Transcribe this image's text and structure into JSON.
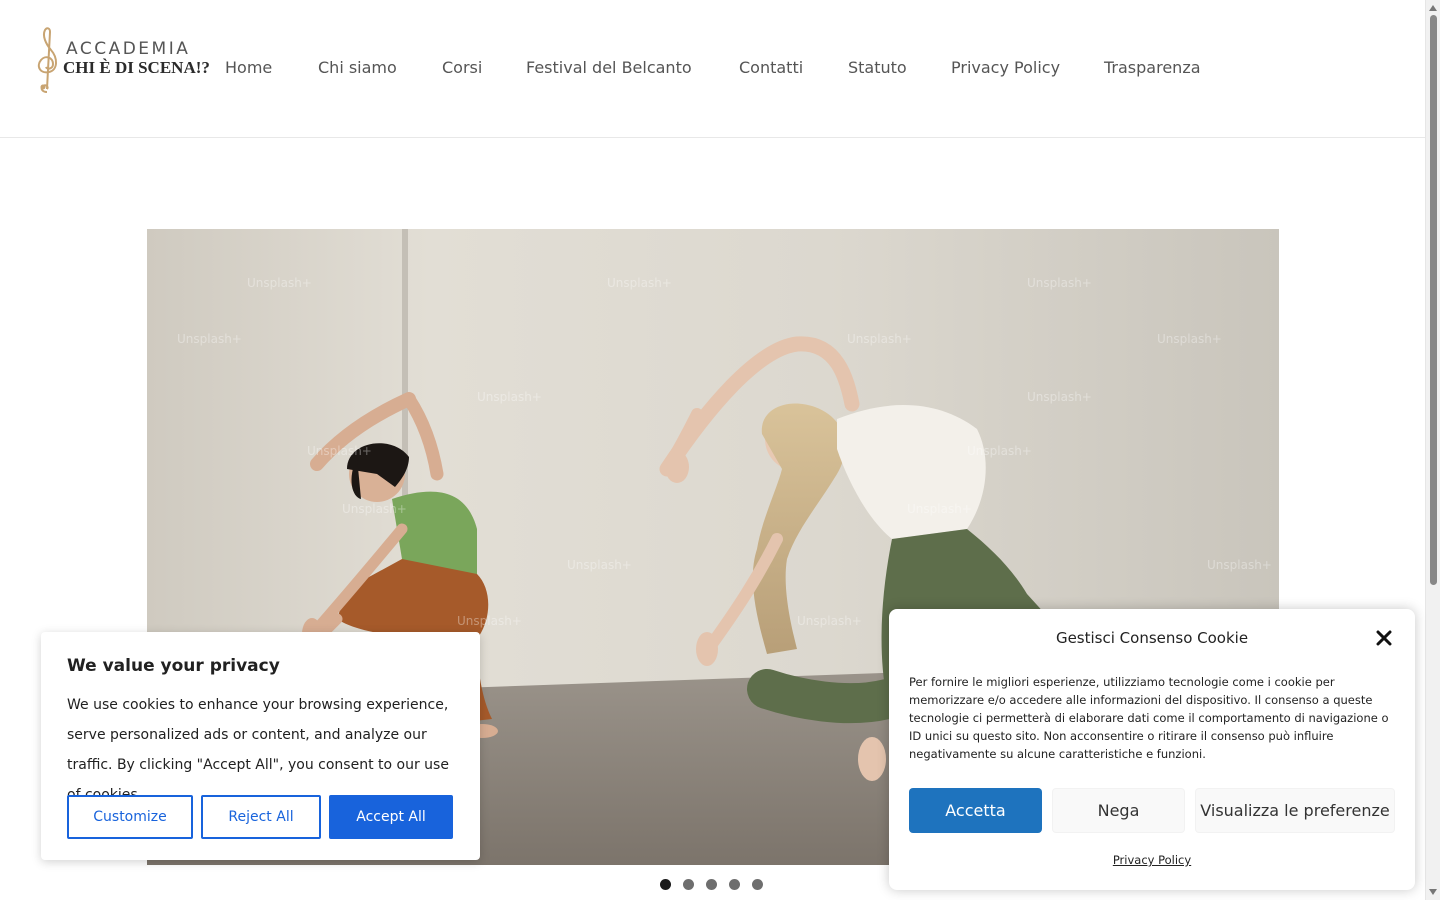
{
  "header": {
    "logo": {
      "line1": "ACCADEMIA",
      "line2": "CHI È DI SCENA!?",
      "icon": "treble-clef-icon",
      "color": "#c8a472"
    },
    "nav": [
      {
        "label": "Home"
      },
      {
        "label": "Chi siamo"
      },
      {
        "label": "Corsi"
      },
      {
        "label": "Festival del Belcanto"
      },
      {
        "label": "Contatti"
      },
      {
        "label": "Statuto"
      },
      {
        "label": "Privacy Policy"
      },
      {
        "label": "Trasparenza"
      }
    ]
  },
  "hero": {
    "watermark": "Unsplash+",
    "slides": 5,
    "active_slide": 1
  },
  "privacy_card": {
    "title": "We value your privacy",
    "text": "We use cookies to enhance your browsing experience, serve personalized ads or content, and analyze our traffic. By clicking \"Accept All\", you consent to our use of cookies.",
    "buttons": {
      "customize": "Customize",
      "reject": "Reject All",
      "accept": "Accept All"
    },
    "accent": "#1863dc"
  },
  "consent": {
    "title": "Gestisci Consenso Cookie",
    "text": "Per fornire le migliori esperienze, utilizziamo tecnologie come i cookie per memorizzare e/o accedere alle informazioni del dispositivo. Il consenso a queste tecnologie ci permetterà di elaborare dati come il comportamento di navigazione o ID unici su questo sito. Non acconsentire o ritirare il consenso può influire negativamente su alcune caratteristiche e funzioni.",
    "buttons": {
      "accept": "Accetta",
      "deny": "Nega",
      "preferences": "Visualizza le preferenze"
    },
    "link": "Privacy Policy",
    "accent": "#1e73be"
  }
}
